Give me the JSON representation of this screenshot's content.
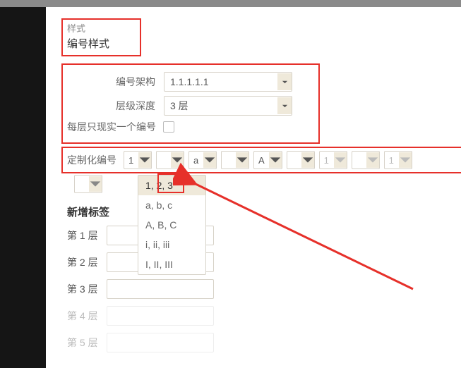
{
  "header": {
    "small": "样式",
    "title": "编号样式"
  },
  "arch": {
    "label": "编号架构",
    "value": "1.1.1.1.1"
  },
  "depth": {
    "label": "层级深度",
    "value": "3 层"
  },
  "onePerLevel": {
    "label": "每层只现实一个编号"
  },
  "custom": {
    "label": "定制化编号",
    "items": [
      {
        "v": "1",
        "disabled": false
      },
      {
        "v": "",
        "disabled": false
      },
      {
        "v": "a",
        "disabled": false
      },
      {
        "v": "",
        "disabled": false
      },
      {
        "v": "A",
        "disabled": false
      },
      {
        "v": "",
        "disabled": false
      },
      {
        "v": "1",
        "disabled": true
      },
      {
        "v": "",
        "disabled": true
      },
      {
        "v": "1",
        "disabled": true
      }
    ]
  },
  "dropdown": {
    "options": [
      {
        "label": "1, 2, 3",
        "selected": true
      },
      {
        "label": "a, b, c",
        "selected": false
      },
      {
        "label": "A, B, C",
        "selected": false
      },
      {
        "label": "i, ii, iii",
        "selected": false
      },
      {
        "label": "I, II, III",
        "selected": false
      }
    ]
  },
  "labelsHeading": "新增标签",
  "layers": [
    {
      "label": "第 1 层",
      "disabled": false
    },
    {
      "label": "第 2 层",
      "disabled": false
    },
    {
      "label": "第 3 层",
      "disabled": false
    },
    {
      "label": "第 4 层",
      "disabled": true
    },
    {
      "label": "第 5 层",
      "disabled": true
    }
  ]
}
